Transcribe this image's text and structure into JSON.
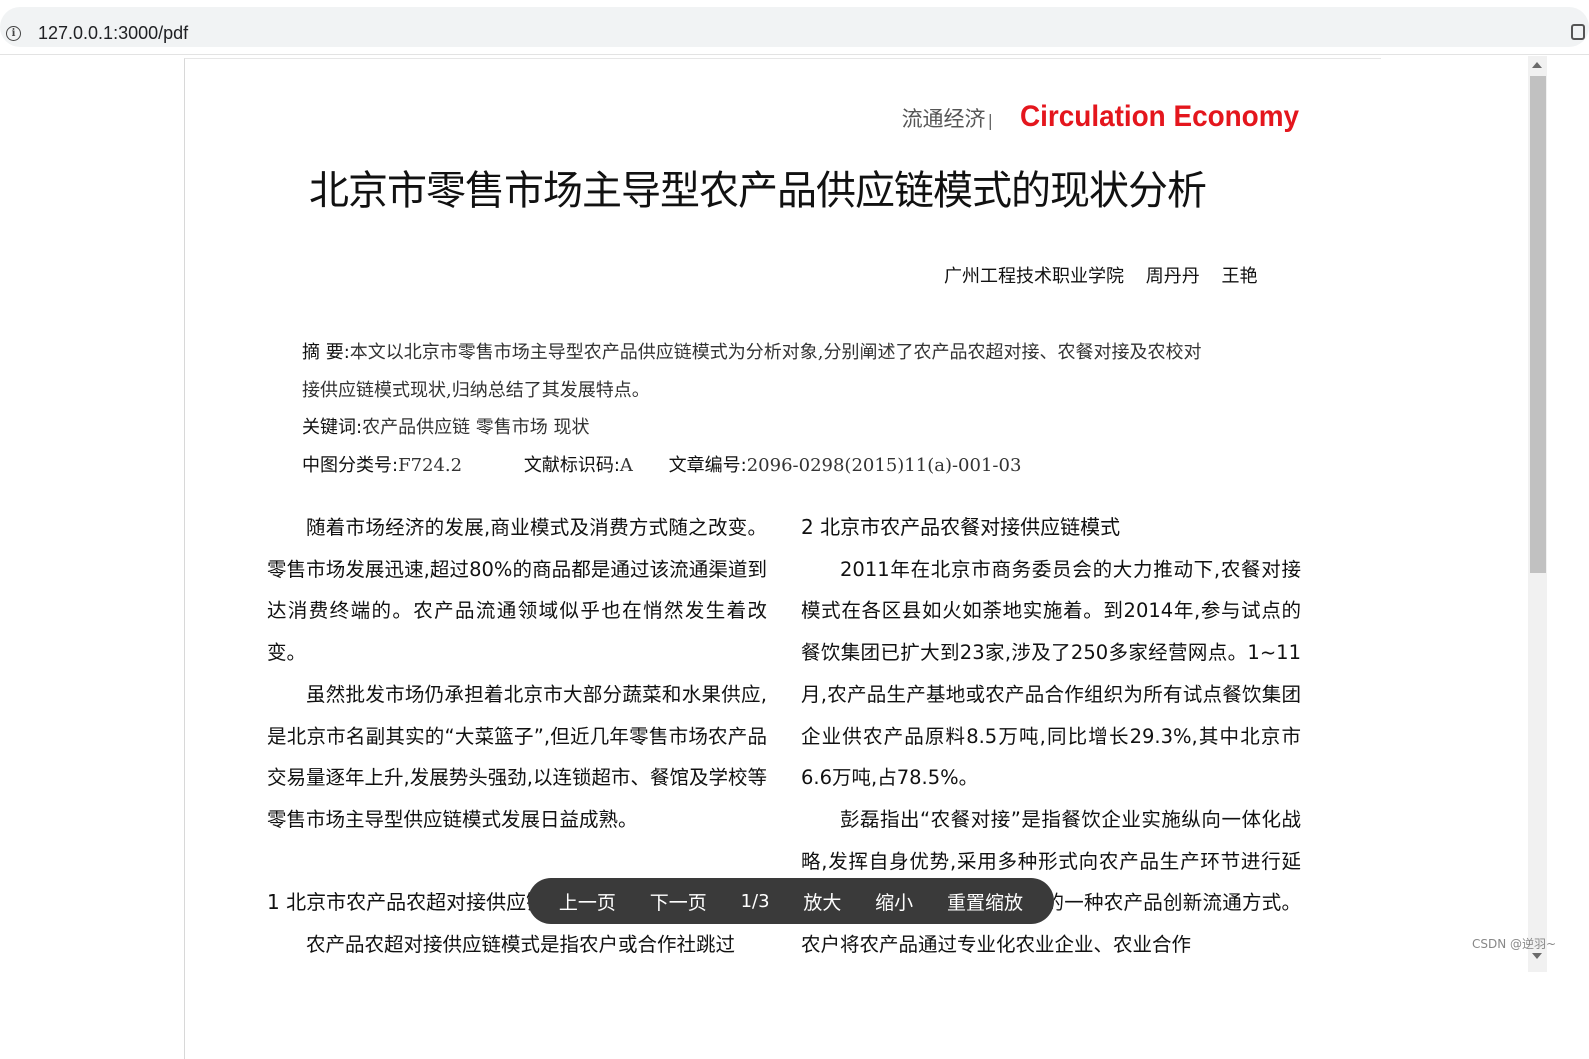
{
  "browser": {
    "url": "127.0.0.1:3000/pdf"
  },
  "paper": {
    "section_cn": "流通经济",
    "section_sep": "|",
    "section_en": "Circulation Economy",
    "title": "北京市零售市场主导型农产品供应链模式的现状分析",
    "affiliation": "广州工程技术职业学院",
    "author1": "周丹丹",
    "author2": "王艳",
    "abstract_label": "摘  要:",
    "abstract_line1": "本文以北京市零售市场主导型农产品供应链模式为分析对象,分别阐述了农产品农超对接、农餐对接及农校对",
    "abstract_line2": "接供应链模式现状,归纳总结了其发展特点。",
    "keywords_label": "关键词:",
    "keywords": "农产品供应链  零售市场  现状",
    "clc_label": "中图分类号:",
    "clc_value": "F724.2",
    "doc_code_label": "文献标识码:",
    "doc_code_value": "A",
    "article_no_label": "文章编号:",
    "article_no_value": "2096-0298(2015)11(a)-001-03",
    "left_col": {
      "p1": "随着市场经济的发展,商业模式及消费方式随之改变。零售市场发展迅速,超过80%的商品都是通过该流通渠道到达消费终端的。农产品流通领域似乎也在悄然发生着改变。",
      "p2": "虽然批发市场仍承担着北京市大部分蔬菜和水果供应,是北京市名副其实的“大菜篮子”,但近几年零售市场农产品交易量逐年上升,发展势头强劲,以连锁超市、餐馆及学校等零售市场主导型供应链模式发展日益成熟。",
      "h1": "1  北京市农产品农超对接供应链模式",
      "p3": "农产品农超对接供应链模式是指农户或合作社跳过"
    },
    "right_col": {
      "h2": "2  北京市农产品农餐对接供应链模式",
      "p1": "2011年在北京市商务委员会的大力推动下,农餐对接模式在各区县如火如荼地实施着。到2014年,参与试点的餐饮集团已扩大到23家,涉及了250多家经营网点。1~11月,农产品生产基地或农产品合作组织为所有试点餐饮集团企业供农产品原料8.5万吨,同比增长29.3%,其中北京市6.6万吨,占78.5%。",
      "p2": "彭磊指出“农餐对接”是指餐饮企业实施纵向一体化战略,发挥自身优势,采用多种形式向农产品生产环节进行延伸,构建能够满足供餐饮企业的一种农产品创新流通方式。农户将农产品通过专业化农业企业、农业合作"
    }
  },
  "toolbar": {
    "prev": "上一页",
    "next": "下一页",
    "page_info": "1/3",
    "zoom_in": "放大",
    "zoom_out": "缩小",
    "reset_zoom": "重置缩放"
  },
  "watermark": "CSDN @逆羽~",
  "colors": {
    "accent_red": "#e4161d",
    "toolbar_bg": "#3a3a3a"
  }
}
